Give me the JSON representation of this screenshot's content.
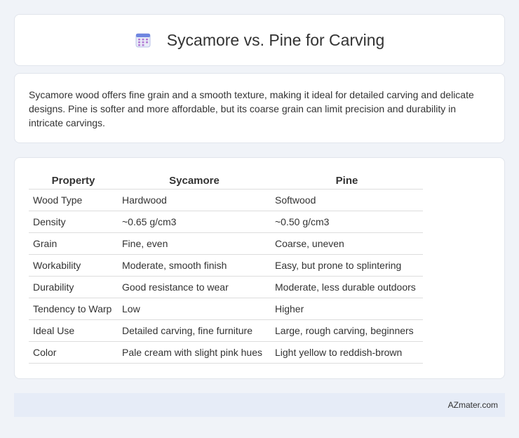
{
  "header": {
    "title": "Sycamore vs. Pine for Carving",
    "icon": "calendar-icon"
  },
  "summary": {
    "text": "Sycamore wood offers fine grain and a smooth texture, making it ideal for detailed carving and delicate designs. Pine is softer and more affordable, but its coarse grain can limit precision and durability in intricate carvings."
  },
  "table": {
    "headers": [
      "Property",
      "Sycamore",
      "Pine"
    ],
    "rows": [
      [
        "Wood Type",
        "Hardwood",
        "Softwood"
      ],
      [
        "Density",
        "~0.65 g/cm3",
        "~0.50 g/cm3"
      ],
      [
        "Grain",
        "Fine, even",
        "Coarse, uneven"
      ],
      [
        "Workability",
        "Moderate, smooth finish",
        "Easy, but prone to splintering"
      ],
      [
        "Durability",
        "Good resistance to wear",
        "Moderate, less durable outdoors"
      ],
      [
        "Tendency to Warp",
        "Low",
        "Higher"
      ],
      [
        "Ideal Use",
        "Detailed carving, fine furniture",
        "Large, rough carving, beginners"
      ],
      [
        "Color",
        "Pale cream with slight pink hues",
        "Light yellow to reddish-brown"
      ]
    ]
  },
  "footer": {
    "brand": "AZmater.com"
  },
  "colors": {
    "background": "#f0f3f8",
    "card": "#ffffff",
    "footer": "#e6ecf7",
    "icon_accent": "#7b8cde"
  }
}
